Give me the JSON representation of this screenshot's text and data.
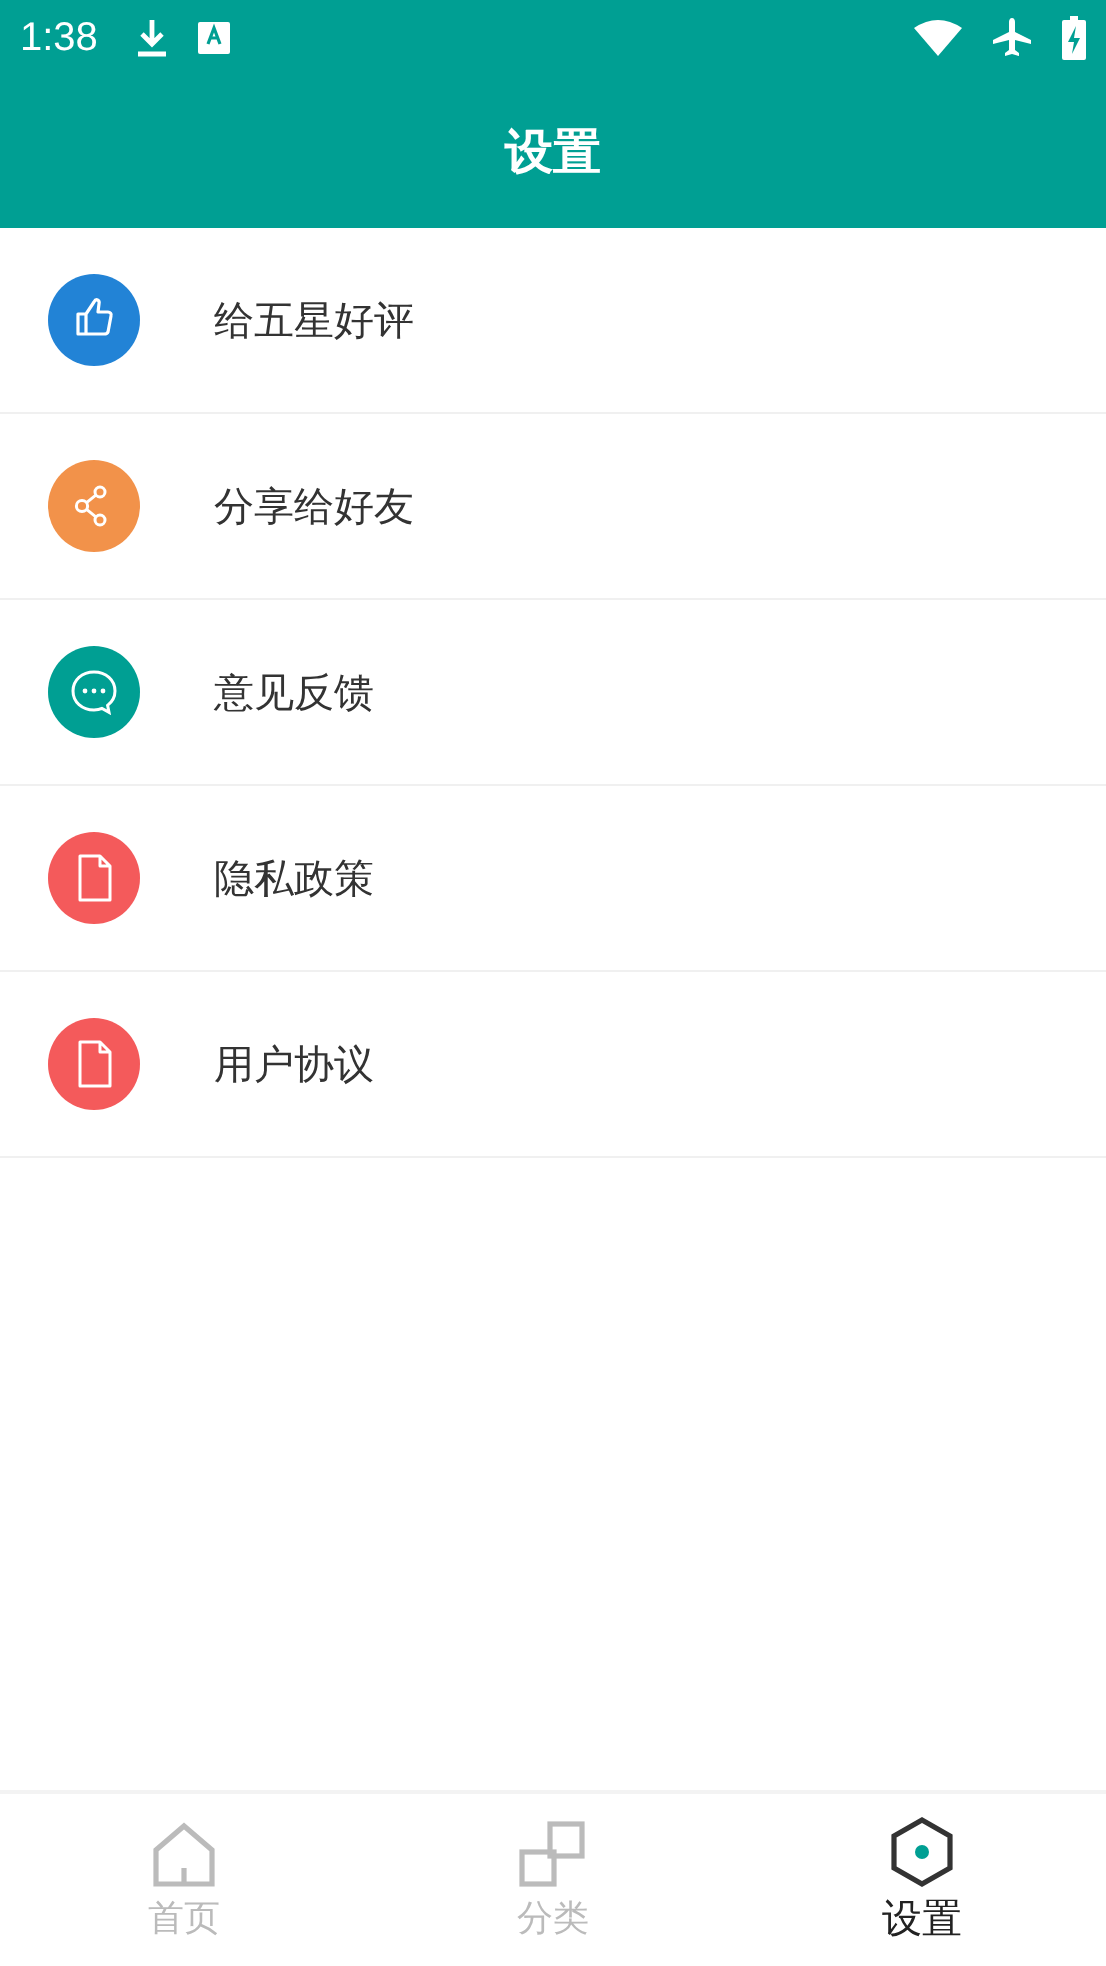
{
  "status_bar": {
    "time": "1:38"
  },
  "header": {
    "title": "设置"
  },
  "items": [
    {
      "label": "给五星好评",
      "kind": "thumb",
      "color": "#2283d6"
    },
    {
      "label": "分享给好友",
      "kind": "share",
      "color": "#f2924a"
    },
    {
      "label": "意见反馈",
      "kind": "chat",
      "color": "#009f93"
    },
    {
      "label": "隐私政策",
      "kind": "document",
      "color": "#f45a5b"
    },
    {
      "label": "用户协议",
      "kind": "document",
      "color": "#f45a5b"
    }
  ],
  "nav": [
    {
      "label": "首页",
      "kind": "home",
      "selected": false
    },
    {
      "label": "分类",
      "kind": "category",
      "selected": false
    },
    {
      "label": "设置",
      "kind": "settings",
      "selected": true
    }
  ]
}
